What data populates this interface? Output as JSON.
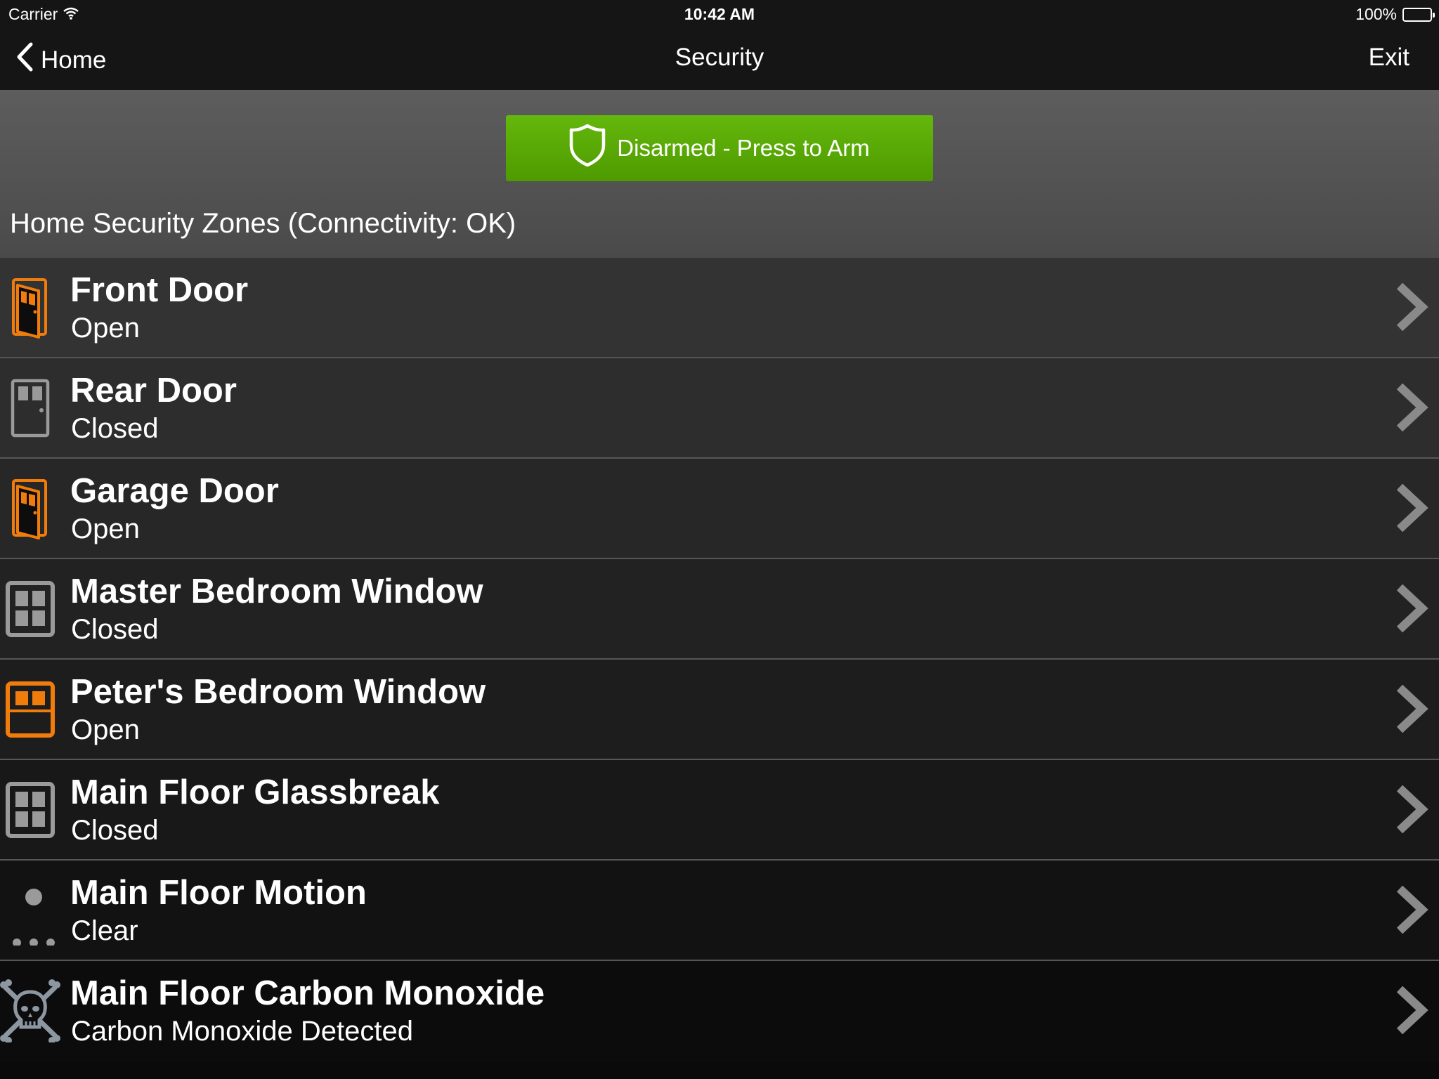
{
  "status_bar": {
    "carrier": "Carrier",
    "time": "10:42 AM",
    "battery": "100%"
  },
  "nav": {
    "back_label": "Home",
    "title": "Security",
    "exit_label": "Exit"
  },
  "arm_button": {
    "label": "Disarmed - Press to Arm",
    "color": "#58a806"
  },
  "zones_header": "Home Security Zones (Connectivity: OK)",
  "colors": {
    "alert": "#f07c0c",
    "normal": "#9a9a9a",
    "chevron": "#8a8a8a"
  },
  "zones": [
    {
      "name": "Front Door",
      "status": "Open",
      "icon": "door-open-icon"
    },
    {
      "name": "Rear Door",
      "status": "Closed",
      "icon": "door-closed-icon"
    },
    {
      "name": "Garage Door",
      "status": "Open",
      "icon": "door-open-icon"
    },
    {
      "name": "Master Bedroom Window",
      "status": "Closed",
      "icon": "window-closed-icon"
    },
    {
      "name": "Peter's Bedroom Window",
      "status": "Open",
      "icon": "window-open-icon"
    },
    {
      "name": "Main Floor Glassbreak",
      "status": "Closed",
      "icon": "window-closed-icon"
    },
    {
      "name": "Main Floor Motion",
      "status": "Clear",
      "icon": "motion-icon"
    },
    {
      "name": "Main Floor Carbon Monoxide",
      "status": "Carbon Monoxide Detected",
      "icon": "skull-crossbones-icon"
    }
  ]
}
